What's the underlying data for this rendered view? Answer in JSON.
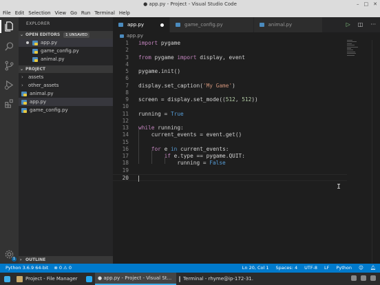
{
  "window": {
    "title": "● app.py - Project - Visual Studio Code"
  },
  "menu": [
    "File",
    "Edit",
    "Selection",
    "View",
    "Go",
    "Run",
    "Terminal",
    "Help"
  ],
  "sidebar": {
    "header": "EXPLORER",
    "open_editors": {
      "label": "OPEN EDITORS",
      "badge": "1 UNSAVED",
      "files": [
        "app.py",
        "game_config.py",
        "animal.py"
      ]
    },
    "project": {
      "label": "PROJECT",
      "items": [
        {
          "name": "assets",
          "type": "folder"
        },
        {
          "name": "other_assets",
          "type": "folder"
        },
        {
          "name": "animal.py",
          "type": "file"
        },
        {
          "name": "app.py",
          "type": "file"
        },
        {
          "name": "game_config.py",
          "type": "file"
        }
      ]
    },
    "outline_label": "OUTLINE"
  },
  "tabs": [
    {
      "label": "app.py",
      "active": true,
      "modified": true
    },
    {
      "label": "game_config.py",
      "active": false,
      "modified": false
    },
    {
      "label": "animal.py",
      "active": false,
      "modified": false
    }
  ],
  "breadcrumb": "app.py",
  "code": [
    {
      "n": "1",
      "parts": [
        [
          "kw",
          "import"
        ],
        [
          "",
          " pygame"
        ]
      ]
    },
    {
      "n": "2",
      "parts": []
    },
    {
      "n": "3",
      "parts": [
        [
          "kw",
          "from"
        ],
        [
          "",
          " pygame "
        ],
        [
          "kw",
          "import"
        ],
        [
          "",
          " display, event"
        ]
      ]
    },
    {
      "n": "4",
      "parts": []
    },
    {
      "n": "5",
      "parts": [
        [
          "",
          "pygame.init()"
        ]
      ]
    },
    {
      "n": "6",
      "parts": []
    },
    {
      "n": "7",
      "parts": [
        [
          "",
          "display.set_caption("
        ],
        [
          "str",
          "'My Game'"
        ],
        [
          "",
          ")"
        ]
      ]
    },
    {
      "n": "8",
      "parts": []
    },
    {
      "n": "9",
      "parts": [
        [
          "",
          "screen = display.set_mode(("
        ],
        [
          "num",
          "512"
        ],
        [
          "",
          ", "
        ],
        [
          "num",
          "512"
        ],
        [
          "",
          "))"
        ]
      ]
    },
    {
      "n": "10",
      "parts": []
    },
    {
      "n": "11",
      "parts": [
        [
          "",
          "running = "
        ],
        [
          "kw2",
          "True"
        ]
      ]
    },
    {
      "n": "12",
      "parts": []
    },
    {
      "n": "13",
      "parts": [
        [
          "kw",
          "while"
        ],
        [
          "",
          " running:"
        ]
      ]
    },
    {
      "n": "14",
      "parts": [
        [
          "",
          "    current_events = event.get()"
        ]
      ]
    },
    {
      "n": "15",
      "parts": []
    },
    {
      "n": "16",
      "parts": [
        [
          "",
          "    "
        ],
        [
          "kw",
          "for"
        ],
        [
          "",
          " e "
        ],
        [
          "kw2",
          "in"
        ],
        [
          "",
          " current_events:"
        ]
      ]
    },
    {
      "n": "17",
      "parts": [
        [
          "",
          "        "
        ],
        [
          "kw",
          "if"
        ],
        [
          "",
          " e.type == pygame.QUIT:"
        ]
      ]
    },
    {
      "n": "18",
      "parts": [
        [
          "",
          "            running = "
        ],
        [
          "kw2",
          "False"
        ]
      ]
    },
    {
      "n": "19",
      "parts": []
    },
    {
      "n": "20",
      "parts": []
    }
  ],
  "status": {
    "interpreter": "Python 3.6.9 64-bit",
    "errors": "⊗ 0 ⚠ 0",
    "position": "Ln 20, Col 1",
    "spaces": "Spaces: 4",
    "encoding": "UTF-8",
    "eol": "LF",
    "language": "Python"
  },
  "taskbar": [
    {
      "label": "Project - File Manager",
      "active": false
    },
    {
      "label": "● app.py - Project - Visual St...",
      "active": true
    },
    {
      "label": "Terminal - rhyme@ip-172-31...",
      "active": false
    }
  ],
  "colors": {
    "accent": "#007acc",
    "sidebar": "#252526",
    "editor": "#1e1e1e",
    "activity": "#333333"
  },
  "icons": [
    "files-icon",
    "search-icon",
    "source-control-icon",
    "run-debug-icon",
    "extensions-icon",
    "gear-icon",
    "run-icon",
    "split-editor-icon",
    "more-icon"
  ]
}
